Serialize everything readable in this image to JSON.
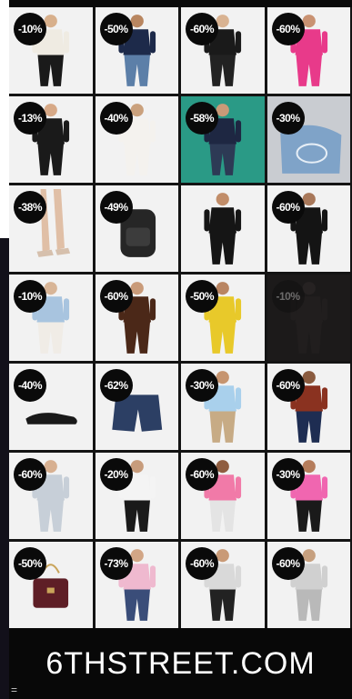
{
  "products": [
    {
      "discount": "-10%",
      "item": "woman-graphic-tee",
      "colors": {
        "top": "#efebe2",
        "bottom": "#1a1a1a",
        "skin": "#d8b08c"
      }
    },
    {
      "discount": "-50%",
      "item": "man-navy-polo",
      "colors": {
        "top": "#1d2a4a",
        "bottom": "#5c7fa8",
        "skin": "#b88660"
      }
    },
    {
      "discount": "-60%",
      "item": "woman-leather-jacket",
      "colors": {
        "top": "#1a1a1a",
        "bottom": "#222222",
        "skin": "#d9b392"
      }
    },
    {
      "discount": "-60%",
      "item": "woman-pink-dress",
      "colors": {
        "top": "#e83a8a",
        "bottom": "#e83a8a",
        "skin": "#c99272"
      }
    },
    {
      "discount": "-13%",
      "item": "black-cycling-shorts",
      "colors": {
        "top": "#1a1a1a",
        "bottom": "#1a1a1a",
        "skin": "#d7a987"
      }
    },
    {
      "discount": "-40%",
      "item": "woman-white-knit-set",
      "colors": {
        "top": "#f4f2ee",
        "bottom": "#f4f2ee",
        "skin": "#caa17d"
      }
    },
    {
      "discount": "-58%",
      "item": "man-navy-graphic-tee",
      "colors": {
        "top": "#1e2742",
        "bottom": "#2d3a55",
        "skin": "#c99a78"
      }
    },
    {
      "discount": "-30%",
      "item": "denim-bag",
      "colors": {
        "top": "#7fa3c8",
        "bottom": "#4f6f94",
        "skin": "#c6b7a5"
      }
    },
    {
      "discount": "-38%",
      "item": "nude-heels",
      "colors": {
        "top": "#e0c7b2",
        "bottom": "#d9b8a0",
        "skin": "#e0bfa6"
      }
    },
    {
      "discount": "-49%",
      "item": "black-backpack",
      "colors": {
        "top": "#262626",
        "bottom": "#333333",
        "skin": "#262626"
      }
    },
    {
      "discount": "",
      "item": "woman-black-jumpsuit",
      "colors": {
        "top": "#151515",
        "bottom": "#151515",
        "skin": "#c18d69"
      }
    },
    {
      "discount": "-60%",
      "item": "woman-black-midi-dress",
      "colors": {
        "top": "#141414",
        "bottom": "#141414",
        "skin": "#a8785a"
      }
    },
    {
      "discount": "-10%",
      "item": "woman-blue-shirt-seated",
      "colors": {
        "top": "#a8c4df",
        "bottom": "#f0ece6",
        "skin": "#d8b597"
      }
    },
    {
      "discount": "-60%",
      "item": "woman-brown-shift-dress",
      "colors": {
        "top": "#4b2818",
        "bottom": "#4b2818",
        "skin": "#c99b7a"
      }
    },
    {
      "discount": "-50%",
      "item": "woman-yellow-dress",
      "colors": {
        "top": "#e8c92a",
        "bottom": "#e8c92a",
        "skin": "#b98562"
      }
    },
    {
      "discount": "-10%",
      "item": "woman-dark-outfit",
      "colors": {
        "top": "#2c2727",
        "bottom": "#2c2727",
        "skin": "#3a3232"
      }
    },
    {
      "discount": "-40%",
      "item": "black-derby-shoe",
      "colors": {
        "top": "#1a1a1a",
        "bottom": "#1a1a1a",
        "skin": "#1a1a1a"
      }
    },
    {
      "discount": "-62%",
      "item": "denim-shorts",
      "colors": {
        "top": "#2c3f64",
        "bottom": "#2c3f64",
        "skin": "#2c3f64"
      }
    },
    {
      "discount": "-30%",
      "item": "man-light-blue-polo",
      "colors": {
        "top": "#a9d0ec",
        "bottom": "#c7ab85",
        "skin": "#c6946f"
      }
    },
    {
      "discount": "-60%",
      "item": "woman-rust-top-jeans",
      "colors": {
        "top": "#8a3220",
        "bottom": "#1e2d52",
        "skin": "#8a5b3f"
      }
    },
    {
      "discount": "-60%",
      "item": "cutout-swimsuit",
      "colors": {
        "top": "#c7cfd8",
        "bottom": "#c7cfd8",
        "skin": "#d7b091"
      }
    },
    {
      "discount": "-20%",
      "item": "woman-activewear",
      "colors": {
        "top": "#f4f4f4",
        "bottom": "#1a1a1a",
        "skin": "#c79c7c"
      }
    },
    {
      "discount": "-60%",
      "item": "woman-pink-crop-set",
      "colors": {
        "top": "#f17aa8",
        "bottom": "#e4e4e4",
        "skin": "#8f5d40"
      }
    },
    {
      "discount": "-30%",
      "item": "woman-pink-sweater",
      "colors": {
        "top": "#f066b0",
        "bottom": "#1a1a1a",
        "skin": "#b57d5c"
      }
    },
    {
      "discount": "-50%",
      "item": "burgundy-handbag",
      "colors": {
        "top": "#5e1e26",
        "bottom": "#5e1e26",
        "skin": "#5e1e26"
      }
    },
    {
      "discount": "-73%",
      "item": "woman-pink-graphic-tee",
      "colors": {
        "top": "#efb9cf",
        "bottom": "#3a4d79",
        "skin": "#d2a686"
      }
    },
    {
      "discount": "-60%",
      "item": "man-patterned-sweater",
      "colors": {
        "top": "#d9d9d9",
        "bottom": "#222222",
        "skin": "#c99a76"
      }
    },
    {
      "discount": "-60%",
      "item": "man-grey-joggers",
      "colors": {
        "top": "#d0d0d0",
        "bottom": "#b9b9b9",
        "skin": "#c6a07f"
      }
    }
  ],
  "footer": {
    "logo": "6THSTREET.COM"
  },
  "corner": {
    "mark": "="
  }
}
